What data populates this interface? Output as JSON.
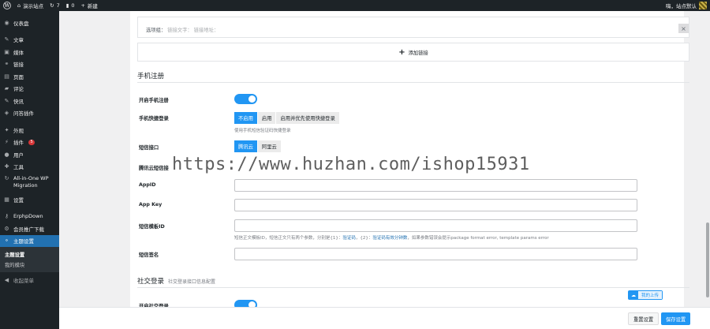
{
  "admin_bar": {
    "site_name": "演示站点",
    "updates_count": "7",
    "comments_count": "0",
    "new_label": "新建",
    "greeting": "嗨，站点默认"
  },
  "sidebar": {
    "items": [
      {
        "label": "仪表盘",
        "icon": "dashboard-icon",
        "glyph": "◉"
      },
      {
        "label": "文章",
        "icon": "pin-icon",
        "glyph": "✎"
      },
      {
        "label": "媒体",
        "icon": "media-icon",
        "glyph": "▣"
      },
      {
        "label": "链接",
        "icon": "link-icon",
        "glyph": "⚭"
      },
      {
        "label": "页面",
        "icon": "page-icon",
        "glyph": "▤"
      },
      {
        "label": "评论",
        "icon": "comment-icon",
        "glyph": "▰"
      },
      {
        "label": "快讯",
        "icon": "pin-icon",
        "glyph": "✎"
      },
      {
        "label": "问答插件",
        "icon": "qa-icon",
        "glyph": "◈"
      },
      {
        "label": "外观",
        "icon": "appearance-icon",
        "glyph": "✦"
      },
      {
        "label": "插件",
        "icon": "plugin-icon",
        "glyph": "⚡",
        "badge": "5"
      },
      {
        "label": "用户",
        "icon": "user-icon",
        "glyph": "●"
      },
      {
        "label": "工具",
        "icon": "tools-icon",
        "glyph": "✚"
      },
      {
        "label": "All-in-One WP Migration",
        "icon": "migration-icon",
        "glyph": "↻"
      },
      {
        "label": "设置",
        "icon": "settings-icon",
        "glyph": "▦"
      },
      {
        "label": "ErphpDown",
        "icon": "key-icon",
        "glyph": "⚷"
      },
      {
        "label": "会员推广下载",
        "icon": "member-icon",
        "glyph": "⚙"
      },
      {
        "label": "主题设置",
        "icon": "theme-settings-icon",
        "glyph": "⚬"
      }
    ],
    "submenu": [
      "主题设置",
      "我的模块"
    ],
    "collapse_label": "收起菜单"
  },
  "link_row": {
    "label": "选项组：",
    "text_placeholder": "链接文字：",
    "url_placeholder": "链接地址："
  },
  "add_link_label": "添加链接",
  "phone_section": {
    "title": "手机注册",
    "enable_label": "开启手机注册",
    "enable_on": true,
    "quick_login_label": "手机快捷登录",
    "quick_login_options": [
      "不启用",
      "启用",
      "启用并优先使用快捷登录"
    ],
    "quick_login_selected": 0,
    "quick_login_help": "使用手机短信验证码快捷登录",
    "sms_label": "短信接口",
    "sms_options": [
      "腾讯云",
      "阿里云"
    ],
    "sms_selected": 0,
    "tencent_header": "腾讯云短信接",
    "appid_label": "AppID",
    "appkey_label": "App Key",
    "template_label": "短信模板ID",
    "template_help_pre": "短信正文模板ID，短信正文只有两个参数，分别是{1}：",
    "template_help_code": "验证码",
    "template_help_mid": "，{2}：",
    "template_help_exp": "验证码有效分钟数",
    "template_help_post": "，如果参数错误会提示package format error, template params error",
    "sign_label": "短信签名"
  },
  "social_section": {
    "title": "社交登录",
    "subtitle": "社交登录接口信息配置",
    "enable_label": "开启社交登录",
    "enable_on": true
  },
  "upload_badge": "我的上传",
  "footer": {
    "reset_label": "重置设置",
    "save_label": "保存设置"
  },
  "watermark": "https://www.huzhan.com/ishop15931"
}
